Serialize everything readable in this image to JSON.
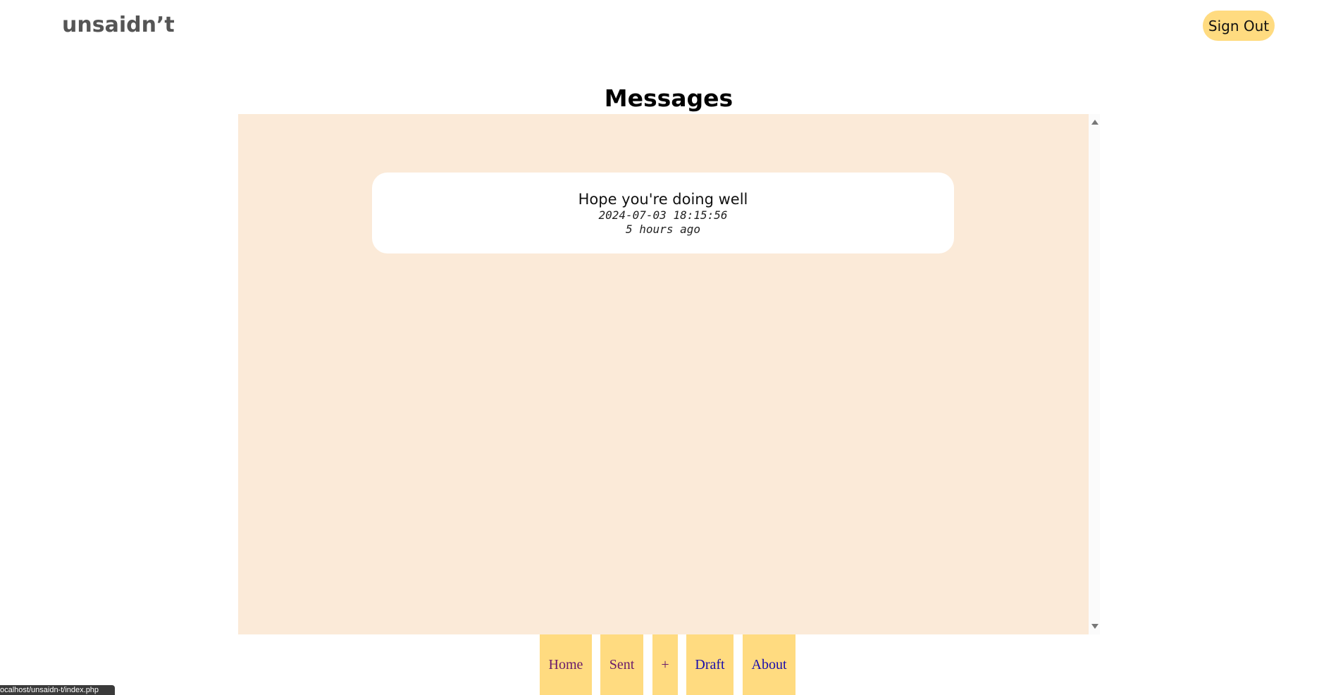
{
  "header": {
    "brand": "unsaidn’t",
    "sign_out_label": "Sign Out"
  },
  "main": {
    "title": "Messages",
    "messages": [
      {
        "title": "Hope you're doing well",
        "timestamp": "2024-07-03 18:15:56",
        "relative_time": "5 hours ago"
      }
    ]
  },
  "nav": {
    "items": [
      {
        "label": "Home"
      },
      {
        "label": "Sent"
      },
      {
        "label": "+"
      },
      {
        "label": "Draft"
      },
      {
        "label": "About"
      }
    ]
  },
  "status_bar": {
    "url": "ocalhost/unsaidn-t/index.php"
  },
  "colors": {
    "accent": "#FFDB80",
    "panel_bg": "#FBEAD8",
    "brand_text": "#555555"
  }
}
